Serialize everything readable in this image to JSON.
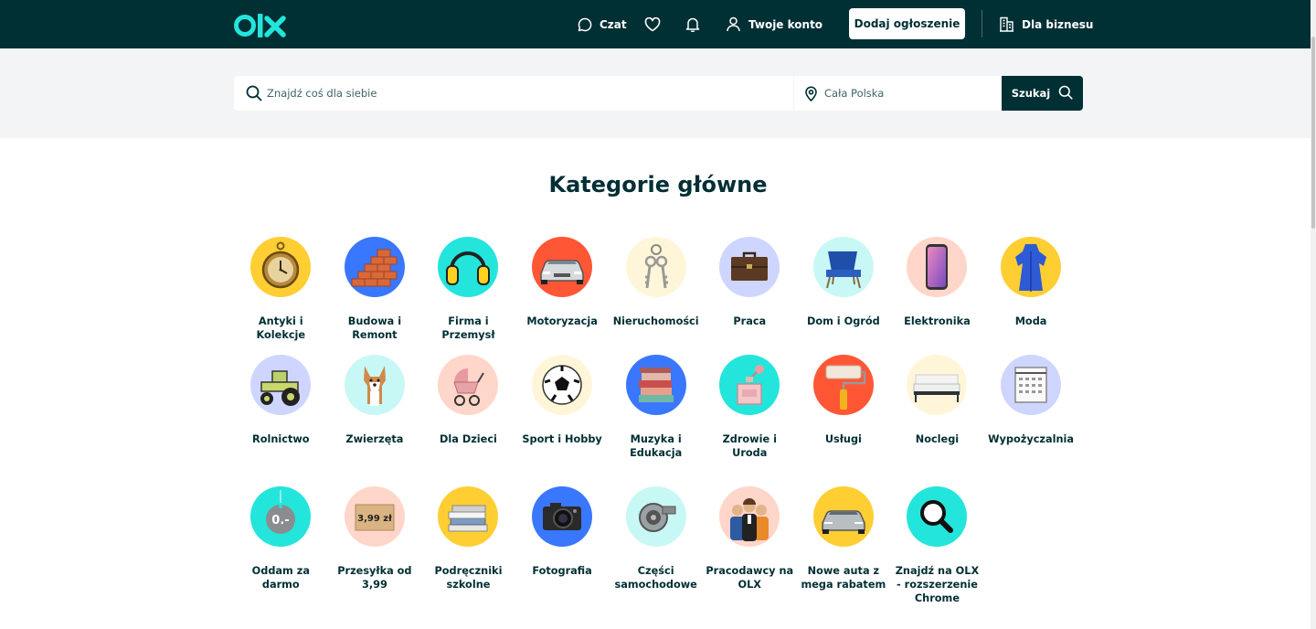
{
  "header": {
    "logo_text": "olx",
    "chat_label": "Czat",
    "account_label": "Twoje konto",
    "add_button_label": "Dodaj ogłoszenie",
    "business_label": "Dla biznesu"
  },
  "search": {
    "query_placeholder": "Znajdź coś dla siebie",
    "location_placeholder": "Cała Polska",
    "button_label": "Szukaj"
  },
  "main": {
    "title": "Kategorie główne",
    "categories": [
      {
        "label": "Antyki i Kolekcje",
        "icon": "pocket-watch-icon",
        "bg": "#ffce32"
      },
      {
        "label": "Budowa i Remont",
        "icon": "bricks-icon",
        "bg": "#3a77ff"
      },
      {
        "label": "Firma i Przemysł",
        "icon": "ear-protectors-icon",
        "bg": "#23e5db"
      },
      {
        "label": "Motoryzacja",
        "icon": "car-icon",
        "bg": "#ff5636"
      },
      {
        "label": "Nieruchomości",
        "icon": "keys-icon",
        "bg": "#fff6d9"
      },
      {
        "label": "Praca",
        "icon": "briefcase-icon",
        "bg": "#ced6ff"
      },
      {
        "label": "Dom i Ogród",
        "icon": "armchair-icon",
        "bg": "#c8f8f6"
      },
      {
        "label": "Elektronika",
        "icon": "smartphone-icon",
        "bg": "#ffd6c9"
      },
      {
        "label": "Moda",
        "icon": "dress-icon",
        "bg": "#ffce32"
      },
      {
        "label": "Rolnictwo",
        "icon": "tractor-icon",
        "bg": "#ced6ff"
      },
      {
        "label": "Zwierzęta",
        "icon": "dog-icon",
        "bg": "#c8f8f6"
      },
      {
        "label": "Dla Dzieci",
        "icon": "stroller-icon",
        "bg": "#ffd6c9"
      },
      {
        "label": "Sport i Hobby",
        "icon": "football-icon",
        "bg": "#fff6d9"
      },
      {
        "label": "Muzyka i Edukacja",
        "icon": "books-icon",
        "bg": "#3a77ff"
      },
      {
        "label": "Zdrowie i Uroda",
        "icon": "perfume-icon",
        "bg": "#23e5db"
      },
      {
        "label": "Usługi",
        "icon": "paint-roller-icon",
        "bg": "#ff5636"
      },
      {
        "label": "Noclegi",
        "icon": "bed-icon",
        "bg": "#fff6d9"
      },
      {
        "label": "Wypożyczalnia",
        "icon": "calendar-icon",
        "bg": "#ced6ff"
      },
      {
        "label": "Oddam za darmo",
        "icon": "price-tag-icon",
        "bg": "#23e5db",
        "tag_text": "0.-"
      },
      {
        "label": "Przesyłka od 3,99",
        "icon": "parcel-icon",
        "bg": "#ffd6c9",
        "tag_text": "3,99 zł"
      },
      {
        "label": "Podręczniki szkolne",
        "icon": "textbooks-icon",
        "bg": "#ffce32"
      },
      {
        "label": "Fotografia",
        "icon": "camera-icon",
        "bg": "#3a77ff"
      },
      {
        "label": "Części samochodowe",
        "icon": "turbocharger-icon",
        "bg": "#c8f8f6"
      },
      {
        "label": "Pracodawcy na OLX",
        "icon": "people-icon",
        "bg": "#ffd6c9"
      },
      {
        "label": "Nowe auta z mega rabatem",
        "icon": "new-car-icon",
        "bg": "#ffce32"
      },
      {
        "label": "Znajdź na OLX - rozszerzenie Chrome",
        "icon": "magnifier-icon",
        "bg": "#23e5db"
      }
    ]
  }
}
